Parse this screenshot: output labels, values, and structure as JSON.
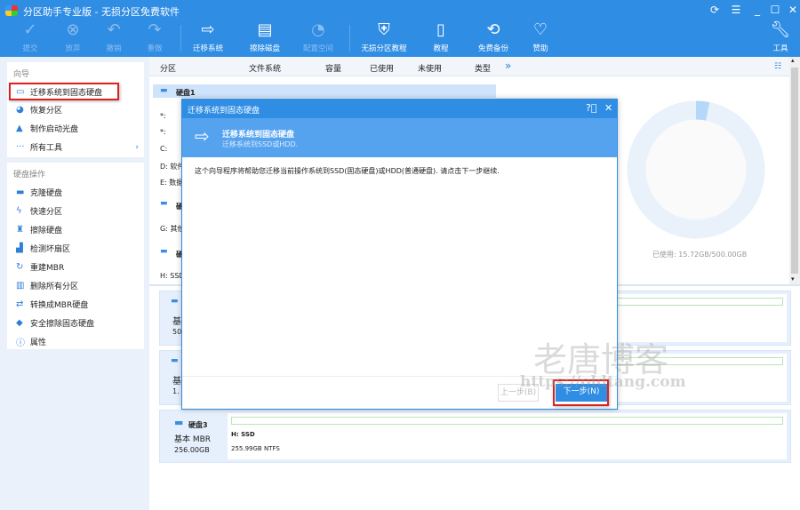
{
  "window": {
    "title": "分区助手专业版 - 无损分区免费软件",
    "controls": [
      "refresh",
      "menu",
      "minimize",
      "maximize",
      "close"
    ]
  },
  "toolbar": [
    {
      "label": "提交",
      "icon": "check-icon",
      "enabled": false
    },
    {
      "label": "放弃",
      "icon": "discard-icon",
      "enabled": false
    },
    {
      "label": "撤销",
      "icon": "undo-icon",
      "enabled": false
    },
    {
      "label": "重做",
      "icon": "redo-icon",
      "enabled": false
    },
    {
      "label": "迁移系统",
      "icon": "migrate-icon",
      "enabled": true
    },
    {
      "label": "擦除磁盘",
      "icon": "wipe-disk-icon",
      "enabled": true
    },
    {
      "label": "配置空间",
      "icon": "allocate-icon",
      "enabled": false
    },
    {
      "label": "无损分区教程",
      "icon": "shield-icon",
      "enabled": true
    },
    {
      "label": "教程",
      "icon": "book-icon",
      "enabled": true
    },
    {
      "label": "免费备份",
      "icon": "backup-icon",
      "enabled": true
    },
    {
      "label": "赞助",
      "icon": "heart-icon",
      "enabled": true
    },
    {
      "label": "工具",
      "icon": "wrench-icon",
      "enabled": true
    }
  ],
  "sidebar": {
    "wizard_title": "向导",
    "wizard": [
      {
        "label": "迁移系统到固态硬盘",
        "icon": "migrate-icon"
      },
      {
        "label": "恢复分区",
        "icon": "recover-icon"
      },
      {
        "label": "制作启动光盘",
        "icon": "bootdisk-icon"
      },
      {
        "label": "所有工具",
        "icon": "more-icon"
      }
    ],
    "disk_ops_title": "硬盘操作",
    "disk_ops": [
      {
        "label": "克隆硬盘",
        "icon": "clone-icon"
      },
      {
        "label": "快速分区",
        "icon": "lightning-icon"
      },
      {
        "label": "擦除硬盘",
        "icon": "wipe-icon"
      },
      {
        "label": "检测坏扇区",
        "icon": "scan-icon"
      },
      {
        "label": "重建MBR",
        "icon": "rebuild-icon"
      },
      {
        "label": "删除所有分区",
        "icon": "trash-icon"
      },
      {
        "label": "转换成MBR硬盘",
        "icon": "convert-icon"
      },
      {
        "label": "安全擦除固态硬盘",
        "icon": "eraser-icon"
      },
      {
        "label": "属性",
        "icon": "info-icon"
      }
    ]
  },
  "table": {
    "headers": [
      "分区",
      "文件系统",
      "容量",
      "已使用",
      "未使用",
      "类型"
    ],
    "more": "»",
    "rows": [
      "硬盘1",
      "*:",
      "*:",
      "C:",
      "D: 软件",
      "E: 数据",
      "硬",
      "G: 其他",
      "硬",
      "H: SSD"
    ]
  },
  "usage": {
    "label": "已使用: 15.72GB/500.00GB",
    "used_gb": 15.72,
    "total_gb": 500.0
  },
  "disks": [
    {
      "name": "",
      "type": "基",
      "size": "50"
    },
    {
      "name": "",
      "type": "基",
      "size": "1."
    },
    {
      "name": "硬盘3",
      "type": "基本 MBR",
      "size": "256.00GB",
      "partition": "H: SSD",
      "detail": "255.99GB NTFS"
    }
  ],
  "dialog": {
    "title": "迁移系统到固态硬盘",
    "heading": "迁移系统到固态硬盘",
    "subheading": "迁移系统到SSD或HDD.",
    "body": "这个向导程序将帮助您迁移当前操作系统到SSD(固态硬盘)或HDD(普通硬盘). 请点击下一步继续.",
    "prev": "上一步(B)",
    "next": "下一步(N)"
  },
  "watermark": {
    "text": "老唐博客",
    "url": "https://oldtang.com"
  }
}
